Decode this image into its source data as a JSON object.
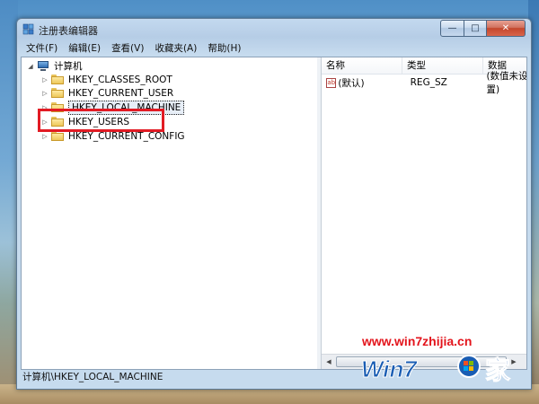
{
  "window": {
    "title": "注册表编辑器",
    "caption_buttons": {
      "minimize": "—",
      "maximize": "□",
      "close": "✕"
    }
  },
  "menu": [
    {
      "label": "文件(F)"
    },
    {
      "label": "编辑(E)"
    },
    {
      "label": "查看(V)"
    },
    {
      "label": "收藏夹(A)"
    },
    {
      "label": "帮助(H)"
    }
  ],
  "tree": {
    "root": {
      "label": "计算机",
      "icon": "computer-icon",
      "expanded": true
    },
    "children": [
      {
        "label": "HKEY_CLASSES_ROOT",
        "icon": "folder-icon"
      },
      {
        "label": "HKEY_CURRENT_USER",
        "icon": "folder-icon"
      },
      {
        "label": "HKEY_LOCAL_MACHINE",
        "icon": "folder-icon",
        "selected": true
      },
      {
        "label": "HKEY_USERS",
        "icon": "folder-icon"
      },
      {
        "label": "HKEY_CURRENT_CONFIG",
        "icon": "folder-icon"
      }
    ]
  },
  "list": {
    "columns": [
      "名称",
      "类型",
      "数据"
    ],
    "rows": [
      {
        "name": "(默认)",
        "type": "REG_SZ",
        "data": "(数值未设置)",
        "icon": "string-value-icon"
      }
    ]
  },
  "status": {
    "path": "计算机\\HKEY_LOCAL_MACHINE"
  },
  "watermark": {
    "url": "www.win7zhijia.cn",
    "logo_text": "Win7",
    "logo_char": "家"
  },
  "colors": {
    "highlight_border": "#e21b24",
    "watermark_red": "#e3141c",
    "logo_blue": "#1a5db3"
  }
}
